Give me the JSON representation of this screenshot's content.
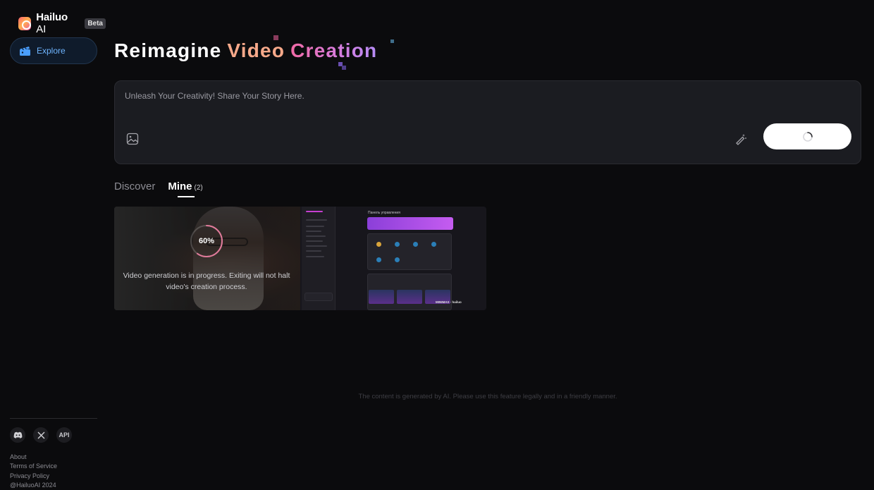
{
  "brand": {
    "name": "Hailuo",
    "name_suffix": "AI",
    "badge": "Beta"
  },
  "sidebar": {
    "items": [
      {
        "label": "Explore",
        "icon": "clapperboard-icon",
        "active": true
      }
    ],
    "socials": [
      {
        "icon": "discord-icon"
      },
      {
        "icon": "x-icon"
      },
      {
        "label": "API"
      }
    ],
    "footer_links": [
      "About",
      "Terms of Service",
      "Privacy Policy"
    ],
    "copyright": "@HailuoAI 2024"
  },
  "hero": {
    "word1": "Reimagine",
    "word2": "Video",
    "word3": "Creation"
  },
  "prompt": {
    "placeholder": "Unleash Your Creativity! Share Your Story Here.",
    "value": ""
  },
  "tabs": [
    {
      "label": "Discover",
      "active": false
    },
    {
      "label": "Mine",
      "count": "(2)",
      "active": true
    }
  ],
  "card": {
    "progress_label": "60%",
    "progress": 0.6,
    "status": "Video generation is in progress. Exiting will not halt video's creation process.",
    "mock_title": "Панель управления",
    "mock_brand": "MINIMAX · hailuo"
  },
  "disclaimer": "The content is generated by AI. Please use this feature legally and in a friendly manner.",
  "colors": {
    "accent_blue": "#6fb5ff",
    "video_orange": "#f7a98a",
    "creation_pink": "#f06aa5",
    "background": "#0b0b0d"
  }
}
